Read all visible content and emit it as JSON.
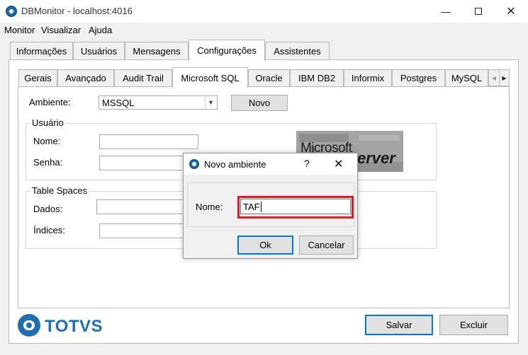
{
  "window": {
    "title": "DBMonitor - localhost:4016",
    "controls": [
      "minimize-icon",
      "maximize-icon",
      "close-icon"
    ]
  },
  "menu": {
    "items": [
      "Monitor",
      "Visualizar",
      "Ajuda"
    ]
  },
  "outer_tabs": [
    "Informações",
    "Usuários",
    "Mensagens",
    "Configurações",
    "Assistentes"
  ],
  "outer_active": "Configurações",
  "inner_tabs": [
    "Gerais",
    "Avançado",
    "Audit Trail",
    "Microsoft SQL",
    "Oracle",
    "IBM DB2",
    "Informix",
    "Postgres",
    "MySQL"
  ],
  "inner_active": "Microsoft SQL",
  "form": {
    "ambiente_label": "Ambiente:",
    "ambiente_value": "MSSQL",
    "novo_button": "Novo",
    "usuario_group": "Usuário",
    "nome_label": "Nome:",
    "senha_label": "Senha:",
    "tablespaces_group": "Table Spaces",
    "dados_label": "Dados:",
    "indices_label": "Índices:"
  },
  "logo": {
    "microsoft_text": "Microsoft",
    "server_text": "erver"
  },
  "dialog": {
    "title": "Novo ambiente",
    "help": "?",
    "nome_label": "Nome:",
    "nome_value": "TAF",
    "ok_button": "Ok",
    "cancel_button": "Cancelar"
  },
  "footer": {
    "brand": "TOTVS",
    "save_button": "Salvar",
    "delete_button": "Excluir"
  },
  "colors": {
    "brand_blue": "#1f6fb5",
    "highlight_red": "#e21b2a"
  }
}
